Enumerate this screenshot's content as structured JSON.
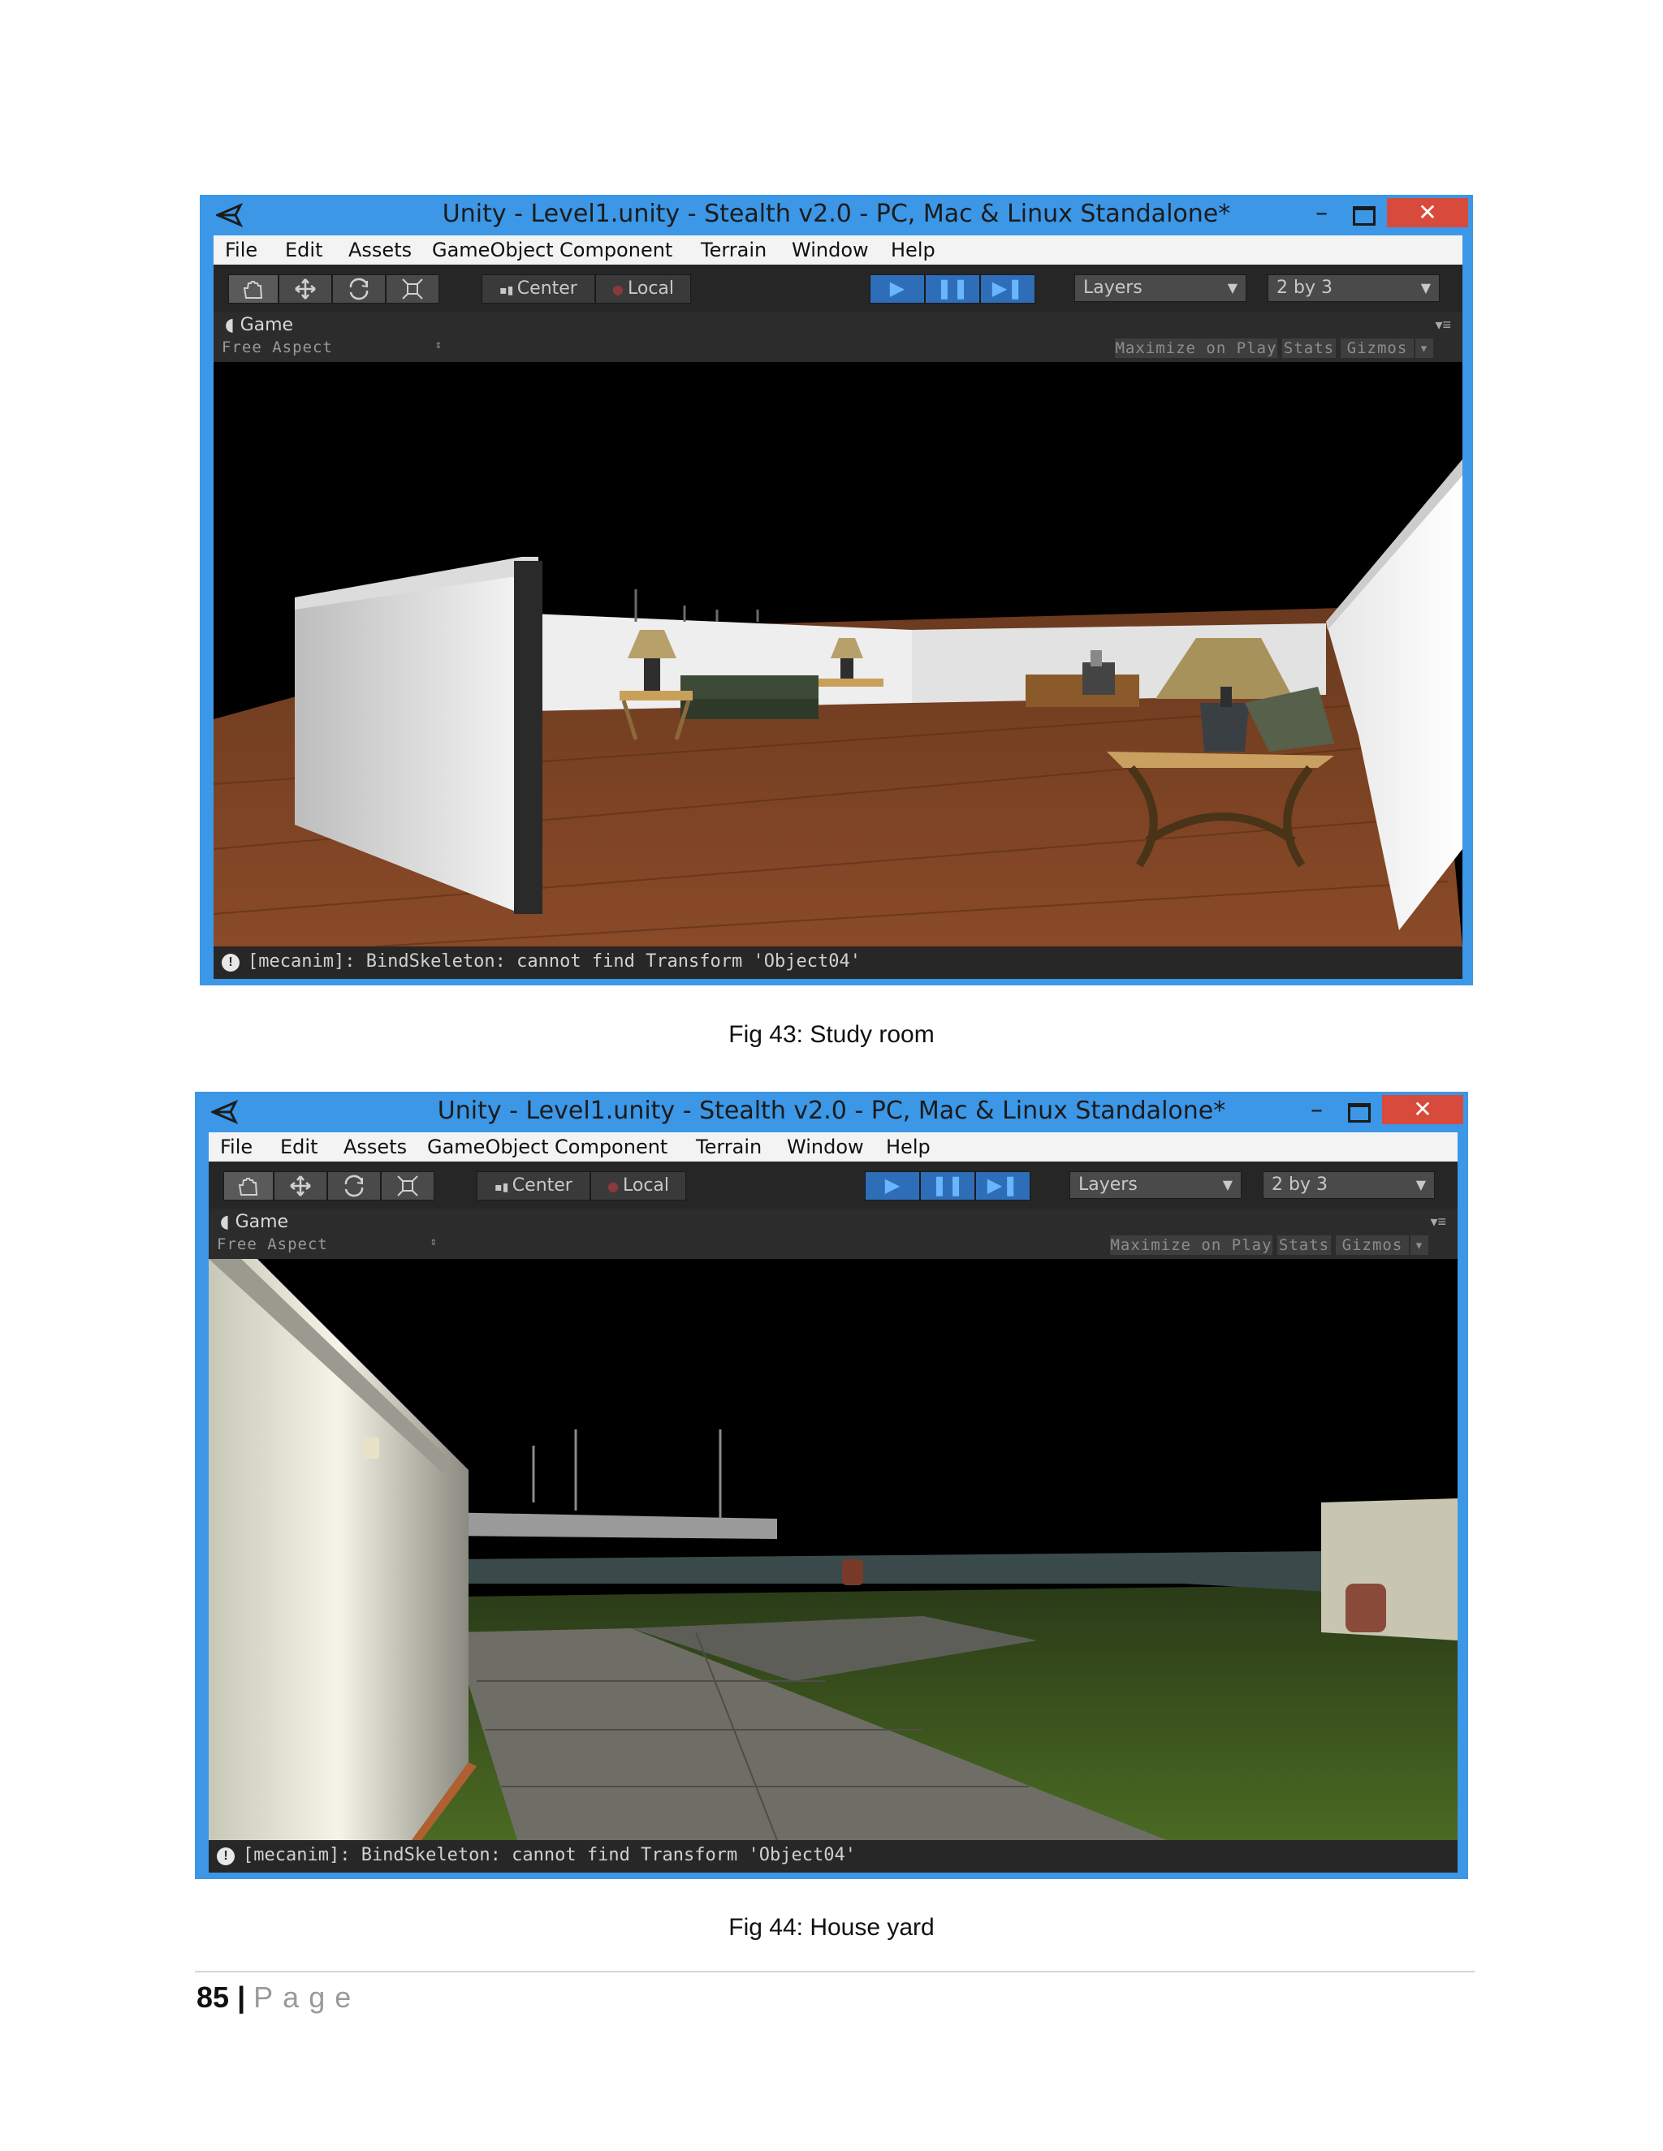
{
  "figures": [
    {
      "window": {
        "title": "Unity - Level1.unity - Stealth v2.0 - PC, Mac & Linux Standalone*",
        "minimize_glyph": "–",
        "close_glyph": "✕"
      },
      "menu": [
        "File",
        "Edit",
        "Assets",
        "GameObject",
        "Component",
        "Terrain",
        "Window",
        "Help"
      ],
      "toolbar": {
        "tools": [
          "hand-icon",
          "move-icon",
          "rotate-icon",
          "scale-icon"
        ],
        "pivot_label": "Center",
        "space_label": "Local",
        "layers_label": "Layers",
        "layout_label": "2 by 3"
      },
      "game_panel": {
        "tab_label": "Game",
        "aspect_label": "Free Aspect",
        "maximize_label": "Maximize on Play",
        "stats_label": "Stats",
        "gizmos_label": "Gizmos"
      },
      "status": "[mecanim]: BindSkeleton: cannot find Transform 'Object04'",
      "scene": "study-room",
      "caption": "Fig 43: Study room"
    },
    {
      "window": {
        "title": "Unity - Level1.unity - Stealth v2.0 - PC, Mac & Linux Standalone*",
        "minimize_glyph": "–",
        "close_glyph": "✕"
      },
      "menu": [
        "File",
        "Edit",
        "Assets",
        "GameObject",
        "Component",
        "Terrain",
        "Window",
        "Help"
      ],
      "toolbar": {
        "tools": [
          "hand-icon",
          "move-icon",
          "rotate-icon",
          "scale-icon"
        ],
        "pivot_label": "Center",
        "space_label": "Local",
        "layers_label": "Layers",
        "layout_label": "2 by 3"
      },
      "game_panel": {
        "tab_label": "Game",
        "aspect_label": "Free Aspect",
        "maximize_label": "Maximize on Play",
        "stats_label": "Stats",
        "gizmos_label": "Gizmos"
      },
      "status": "[mecanim]: BindSkeleton: cannot find Transform 'Object04'",
      "scene": "house-yard",
      "caption": "Fig 44: House yard"
    }
  ],
  "footer": {
    "page_number": "85",
    "separator": "|",
    "page_word": "Page"
  },
  "colors": {
    "window_frame": "#3c97e6",
    "close_button": "#d84a3c",
    "editor_dark": "#262626",
    "play_blue": "#2e6eb8"
  }
}
